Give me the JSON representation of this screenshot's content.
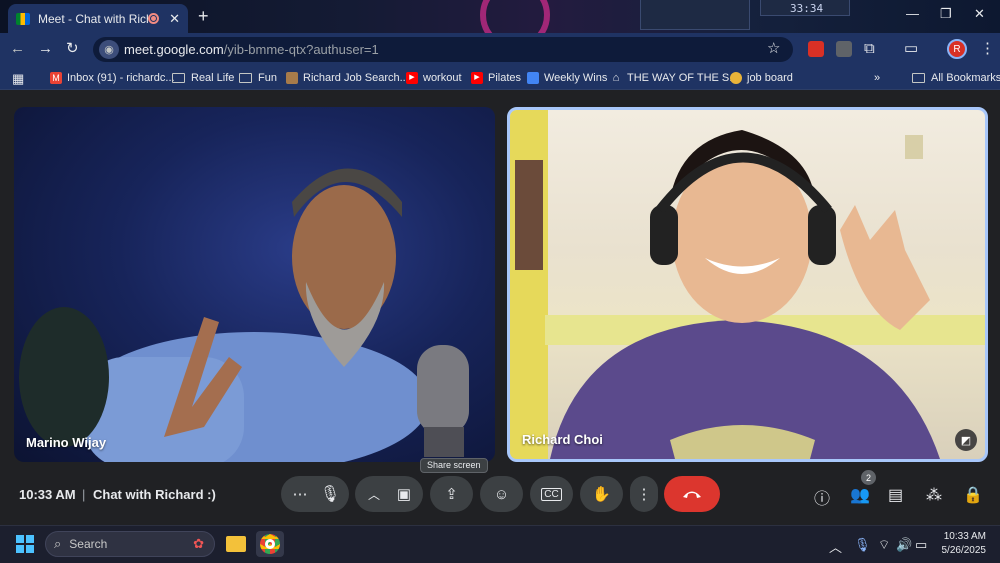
{
  "browser": {
    "tab": {
      "title": "Meet - Chat with Richard :)"
    },
    "url_host": "meet.google.com",
    "url_path": "/yib-bmme-qtx?authuser=1",
    "profile_initial": "R",
    "bookmarks": [
      {
        "label": "Inbox (91) - richardc...",
        "icon": "gmail-icon"
      },
      {
        "label": "Real Life",
        "icon": "folder-icon"
      },
      {
        "label": "Fun",
        "icon": "folder-icon"
      },
      {
        "label": "Richard Job Search...",
        "icon": "bookmark-icon"
      },
      {
        "label": "workout",
        "icon": "youtube-icon"
      },
      {
        "label": "Pilates",
        "icon": "youtube-icon"
      },
      {
        "label": "Weekly Wins",
        "icon": "people-icon"
      },
      {
        "label": "THE WAY OF THE S...",
        "icon": "building-icon"
      },
      {
        "label": "job board",
        "icon": "bookmark-icon"
      }
    ],
    "all_bookmarks": "All Bookmarks",
    "deco_clock": "33:34"
  },
  "meet": {
    "participants": [
      {
        "name": "Marino Wijay"
      },
      {
        "name": "Richard Choi"
      }
    ],
    "tooltip": "Share screen",
    "time": "10:33 AM",
    "separator": "|",
    "meeting_title": "Chat with Richard :)",
    "people_count": "2",
    "colors": {
      "end_call": "#dc362e",
      "active_border": "#a8c7fa"
    }
  },
  "taskbar": {
    "search_placeholder": "Search",
    "time": "10:33 AM",
    "date": "5/26/2025"
  }
}
